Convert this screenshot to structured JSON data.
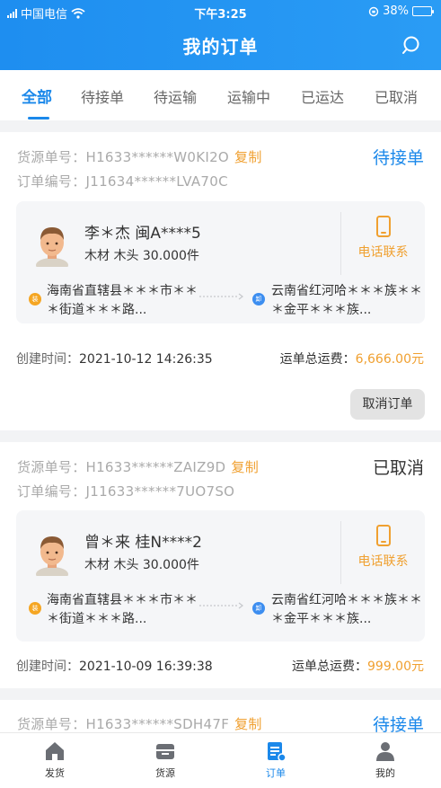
{
  "statusbar": {
    "carrier": "中国电信",
    "time": "下午3:25",
    "battery": "38%",
    "battery_level": 0.38
  },
  "header": {
    "title": "我的订单"
  },
  "tabs": [
    "全部",
    "待接单",
    "待运输",
    "运输中",
    "已运达",
    "已取消"
  ],
  "orders": [
    {
      "source_no": "货源单号：H1633******W0KI2O",
      "order_no": "订单编号：J11634******LVA70C",
      "copy_label": "复制",
      "status": "待接单",
      "driver": "李＊杰 闽A****5",
      "goods": "木材 木头 30.000件",
      "contact_label": "电话联系",
      "from_tag": "装",
      "from": "海南省直辖县＊＊＊市＊＊＊街道＊＊＊路...",
      "to_tag": "卸",
      "to": "云南省红河哈＊＊＊族＊＊＊金平＊＊＊族...",
      "created_label": "创建时间：",
      "created": "2021-10-12 14:26:35",
      "fee_label": "运单总运费：",
      "fee": "6,666.00元",
      "cancel_label": "取消订单"
    },
    {
      "source_no": "货源单号：H1633******ZAIZ9D",
      "order_no": "订单编号：J11633******7UO7SO",
      "copy_label": "复制",
      "status": "已取消",
      "driver": "曾＊来 桂N****2",
      "goods": "木材 木头 30.000件",
      "contact_label": "电话联系",
      "from_tag": "装",
      "from": "海南省直辖县＊＊＊市＊＊＊街道＊＊＊路...",
      "to_tag": "卸",
      "to": "云南省红河哈＊＊＊族＊＊＊金平＊＊＊族...",
      "created_label": "创建时间：",
      "created": "2021-10-09 16:39:38",
      "fee_label": "运单总运费：",
      "fee": "999.00元"
    },
    {
      "source_no": "货源单号：H1633******SDH47F",
      "copy_label": "复制",
      "status": "待接单"
    }
  ],
  "nav": [
    "发货",
    "货源",
    "订单",
    "我的"
  ]
}
